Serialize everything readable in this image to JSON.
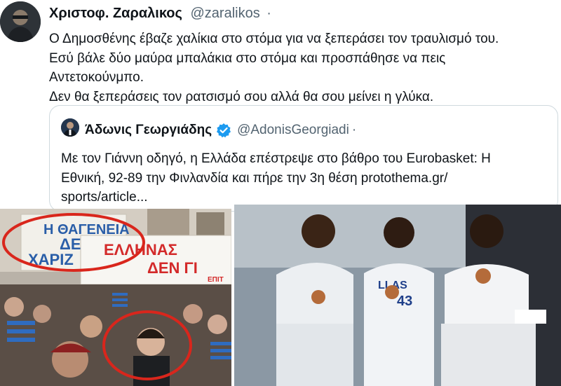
{
  "tweet": {
    "author_name": "Χριστοφ. Ζαραλικος",
    "author_handle": "@zaralikos",
    "separator": "·",
    "lines": [
      "Ο Δημοσθένης έβαζε χαλίκια στο στόμα για να ξεπεράσει τον τραυλισμό του.",
      "Εσύ βάλε δύο μαύρα μπαλάκια στο στόμα και προσπάθησε να πεις",
      "Αντετοκούνμπο.",
      "Δεν θα ξεπεράσεις τον ρατσισμό σου αλλά θα σου μείνει η γλύκα."
    ]
  },
  "quote": {
    "author_name": "Άδωνις Γεωργιάδης",
    "author_handle": "@AdonisGeorgiadi",
    "separator": "·",
    "lines": [
      "Με τον Γιάννη οδηγό, η Ελλάδα επέστρεψε στο βάθρο του Eurobasket: Η",
      "Εθνική, 92-89 την Φινλανδία και πήρε την 3η θέση protothema.gr/",
      "sports/article..."
    ]
  },
  "photo_left": {
    "banner_top": "Η ΘΑΓΕΝΕΙΑ",
    "banner_top_2": "ΔΕΝ",
    "banner_top_3": "ΧΑΡΙΖ",
    "banner_bottom": "ΕΛΛΗΝΑΣ",
    "banner_bottom_2": "ΔΕΝ ΓΙ",
    "banner_small": "ΕΠΙΤ"
  },
  "photo_right": {
    "jersey_text": "LLAS",
    "jersey_number": "43"
  },
  "colors": {
    "text": "#0f1419",
    "muted": "#536471",
    "border": "#cfd9de",
    "verified": "#1d9bf0",
    "highlight": "#d9261c"
  }
}
